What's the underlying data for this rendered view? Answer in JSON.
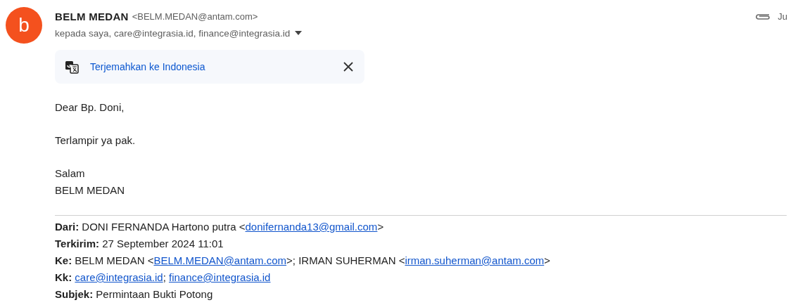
{
  "sender": {
    "avatar_letter": "b",
    "name": "BELM MEDAN",
    "address": "<BELM.MEDAN@antam.com>",
    "recipients": "kepada saya, care@integrasia.id, finance@integrasia.id",
    "date": "Ju"
  },
  "translate_bar": {
    "label": "Terjemahkan ke Indonesia"
  },
  "body": [
    {
      "lines": [
        "Dear Bp. Doni,"
      ]
    },
    {
      "lines": [
        "Terlampir ya pak."
      ]
    },
    {
      "lines": [
        "Salam",
        "BELM MEDAN"
      ]
    }
  ],
  "quoted_header": [
    {
      "label": "Dari:",
      "parts": [
        {
          "kind": "text",
          "text": "DONI FERNANDA Hartono putra <"
        },
        {
          "kind": "link",
          "text": "donifernanda13@gmail.com"
        },
        {
          "kind": "text",
          "text": ">"
        }
      ]
    },
    {
      "label": "Terkirim:",
      "parts": [
        {
          "kind": "text",
          "text": "27 September 2024 11:01"
        }
      ]
    },
    {
      "label": "Ke:",
      "parts": [
        {
          "kind": "text",
          "text": "BELM MEDAN <"
        },
        {
          "kind": "link",
          "text": "BELM.MEDAN@antam.com"
        },
        {
          "kind": "text",
          "text": ">; IRMAN SUHERMAN <"
        },
        {
          "kind": "link",
          "text": "irman.suherman@antam.com"
        },
        {
          "kind": "text",
          "text": ">"
        }
      ]
    },
    {
      "label": "Kk:",
      "parts": [
        {
          "kind": "link",
          "text": "care@integrasia.id"
        },
        {
          "kind": "text",
          "text": "; "
        },
        {
          "kind": "link",
          "text": "finance@integrasia.id"
        }
      ]
    },
    {
      "label": "Subjek:",
      "parts": [
        {
          "kind": "text",
          "text": "Permintaan Bukti Potong"
        }
      ]
    }
  ]
}
